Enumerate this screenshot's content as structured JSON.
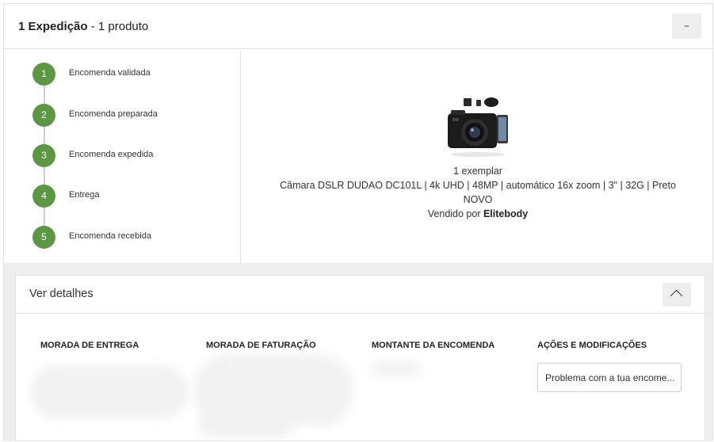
{
  "shipment": {
    "title_bold": "1 Expedição",
    "title_rest": " - 1 produto",
    "collapse_label": "–"
  },
  "steps": [
    {
      "num": "1",
      "label": "Encomenda validada"
    },
    {
      "num": "2",
      "label": "Encomenda preparada"
    },
    {
      "num": "3",
      "label": "Encomenda expedida"
    },
    {
      "num": "4",
      "label": "Entrega"
    },
    {
      "num": "5",
      "label": "Encomenda recebida"
    }
  ],
  "product": {
    "quantity": "1 exemplar",
    "name": "Câmara DSLR DUDAO DC101L | 4k UHD | 48MP | automático 16x zoom | 3\" | 32G | Preto",
    "condition": "NOVO",
    "sold_by_prefix": "Vendido por ",
    "seller": "Elitebody"
  },
  "details": {
    "title": "Ver detalhes",
    "columns": {
      "delivery_address": "MORADA DE ENTREGA",
      "billing_address": "MORADA DE FATURAÇÃO",
      "order_amount": "MONTANTE DA ENCOMENDA",
      "actions": "AÇÕES E MODIFICAÇÕES"
    },
    "action_select": "Problema com a tua encome..."
  },
  "colors": {
    "step_green": "#5c9844",
    "band_grey": "#eeeeee"
  }
}
